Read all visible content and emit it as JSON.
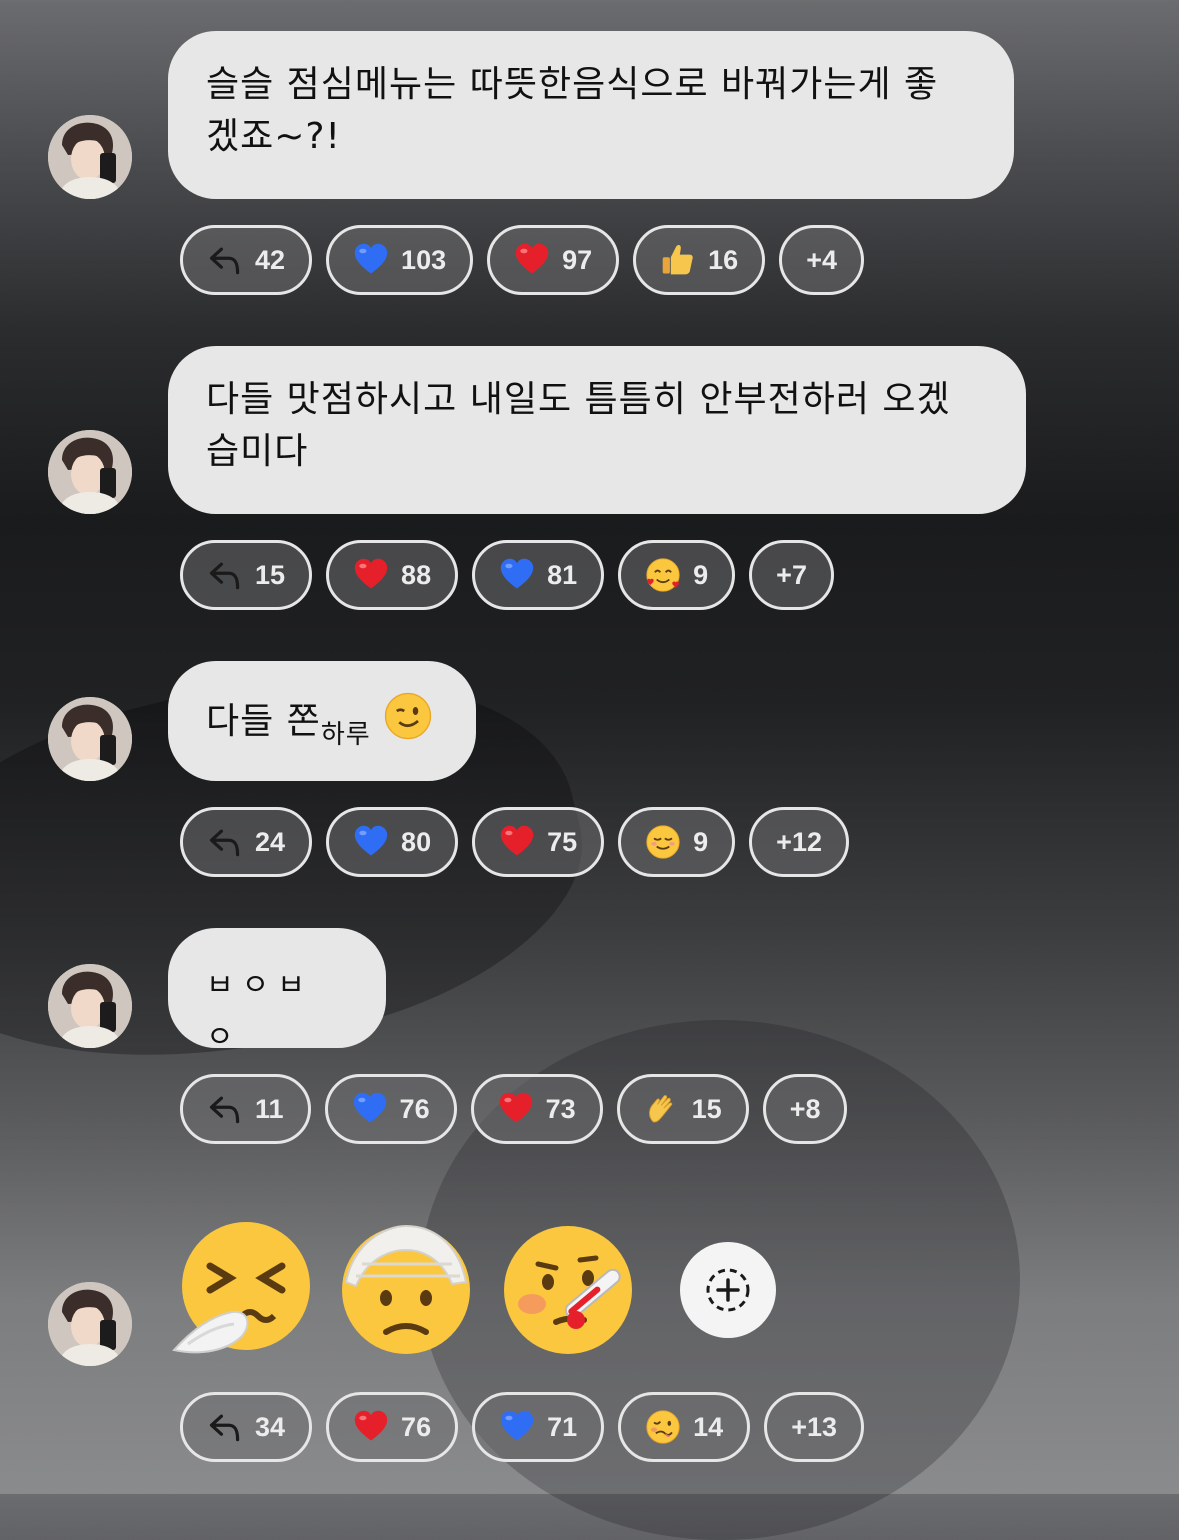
{
  "colors": {
    "bubble": "#e7e7e8",
    "pill_border": "#e6e6e6",
    "heart_blue": "#2f6df5",
    "heart_red": "#e5202a"
  },
  "messages": [
    {
      "text_lines": [
        "슬슬 점심메뉴는 따뜻한음식으로 바꿔가는게 좋",
        "겠죠~?!"
      ],
      "reactions": [
        {
          "icon": "reply-arrow-icon",
          "count": "42"
        },
        {
          "icon": "blue-heart-icon",
          "count": "103"
        },
        {
          "icon": "red-heart-icon",
          "count": "97"
        },
        {
          "icon": "thumbs-up-icon",
          "count": "16"
        },
        {
          "icon": "",
          "count": "+4"
        }
      ]
    },
    {
      "text_lines": [
        "다들 맛점하시고 내일도 틈틈히 안부전하러 오겠",
        "습미다"
      ],
      "reactions": [
        {
          "icon": "reply-arrow-icon",
          "count": "15"
        },
        {
          "icon": "red-heart-icon",
          "count": "88"
        },
        {
          "icon": "blue-heart-icon",
          "count": "81"
        },
        {
          "icon": "smiling-face-hearts-icon",
          "count": "9"
        },
        {
          "icon": "",
          "count": "+7"
        }
      ]
    },
    {
      "text_main": "다들 쫀",
      "text_sub": "하루",
      "reactions": [
        {
          "icon": "reply-arrow-icon",
          "count": "24"
        },
        {
          "icon": "blue-heart-icon",
          "count": "80"
        },
        {
          "icon": "red-heart-icon",
          "count": "75"
        },
        {
          "icon": "smiling-face-icon",
          "count": "9"
        },
        {
          "icon": "",
          "count": "+12"
        }
      ]
    },
    {
      "text_lines": [
        "ㅂㅇㅂㅇ"
      ],
      "reactions": [
        {
          "icon": "reply-arrow-icon",
          "count": "11"
        },
        {
          "icon": "blue-heart-icon",
          "count": "76"
        },
        {
          "icon": "red-heart-icon",
          "count": "73"
        },
        {
          "icon": "waving-hand-icon",
          "count": "15"
        },
        {
          "icon": "",
          "count": "+8"
        }
      ]
    },
    {
      "emojis": [
        "sneezing-face-icon",
        "head-bandage-face-icon",
        "thermometer-face-icon"
      ],
      "reactions": [
        {
          "icon": "reply-arrow-icon",
          "count": "34"
        },
        {
          "icon": "red-heart-icon",
          "count": "76"
        },
        {
          "icon": "blue-heart-icon",
          "count": "71"
        },
        {
          "icon": "woozy-face-icon",
          "count": "14"
        },
        {
          "icon": "",
          "count": "+13"
        }
      ]
    }
  ]
}
